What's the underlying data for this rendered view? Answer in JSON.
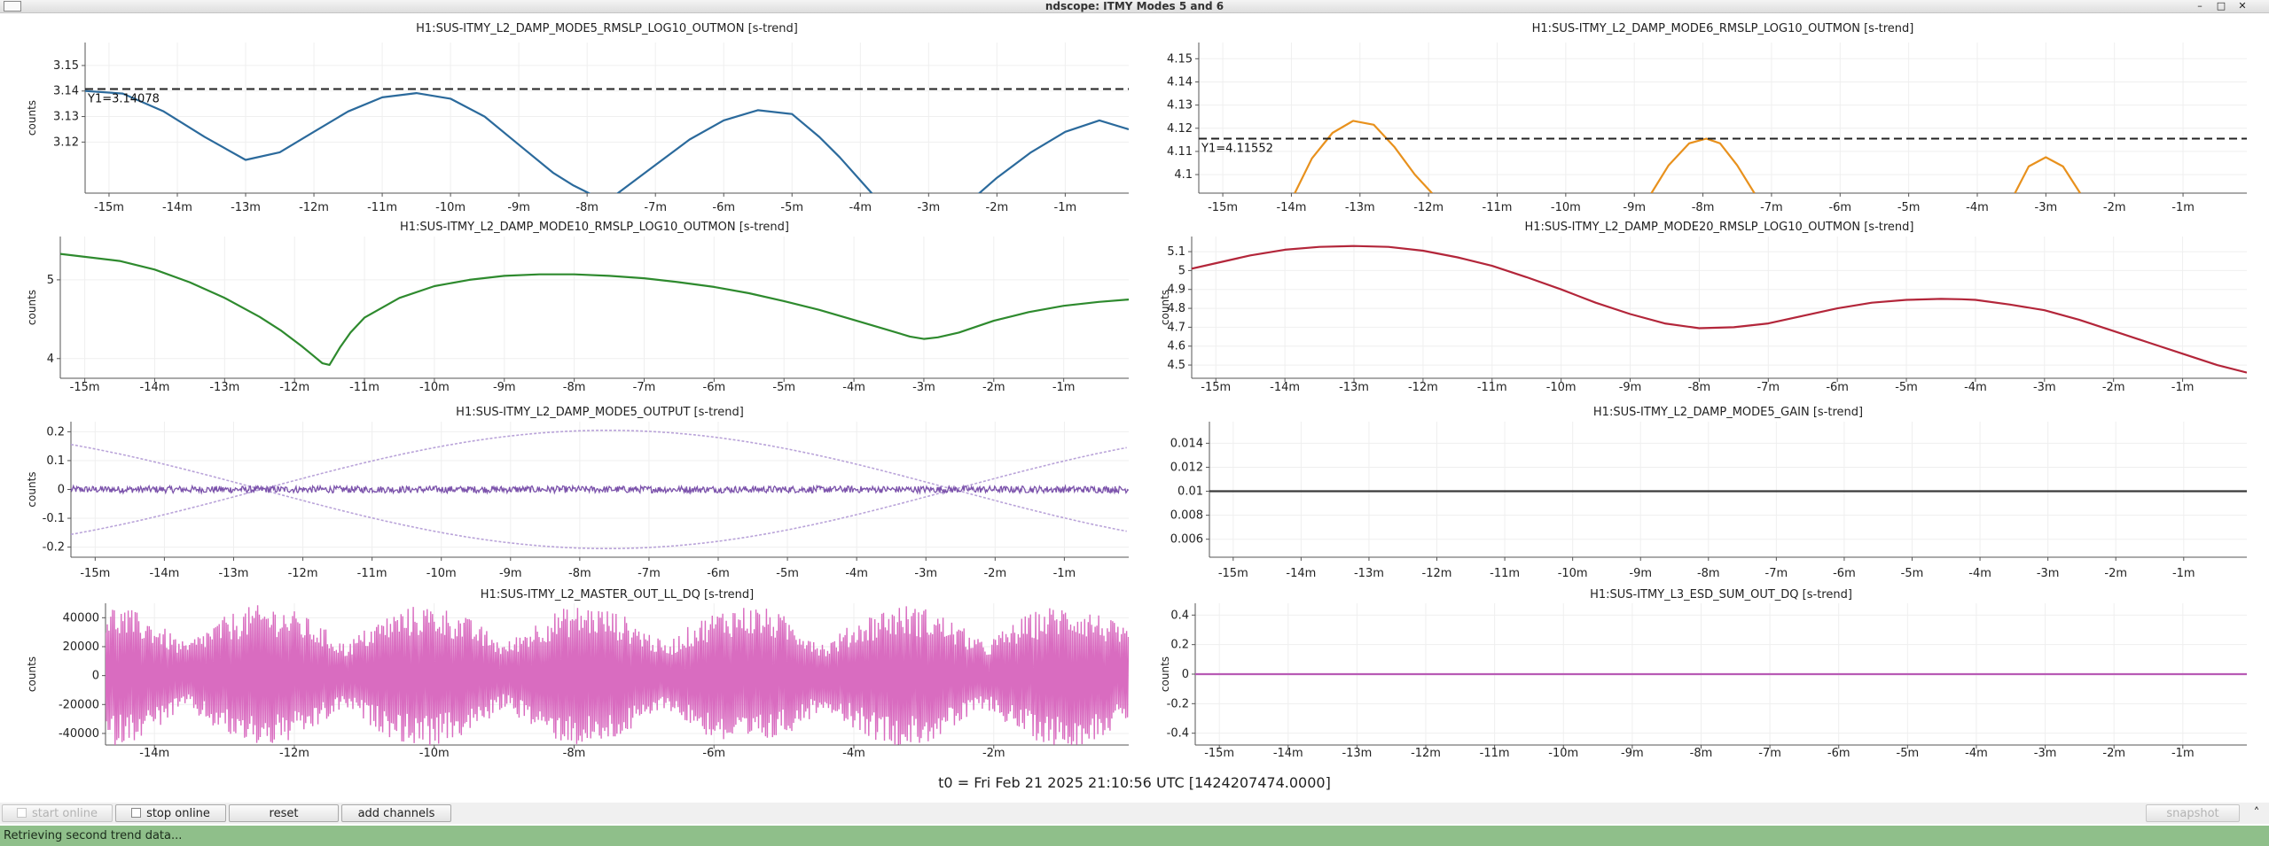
{
  "window": {
    "title": "ndscope: ITMY Modes 5 and 6",
    "minimize_glyph": "–",
    "maximize_glyph": "□",
    "close_glyph": "✕",
    "expand_glyph": "˄"
  },
  "footer": {
    "t0": "t0 = Fri Feb 21 2025 21:10:56 UTC [1424207474.0000]",
    "status": "Retrieving second trend data...",
    "buttons": {
      "start_online": "start online",
      "stop_online": "stop online",
      "reset": "reset",
      "add_channels": "add channels",
      "snapshot": "snapshot"
    }
  },
  "chart_data": [
    {
      "id": "p1",
      "type": "line",
      "title": "H1:SUS-ITMY_L2_DAMP_MODE5_RMSLP_LOG10_OUTMON [s-trend]",
      "ylabel": "counts",
      "color": "#2b6a9c",
      "xlim": [
        -15.35,
        -0.07
      ],
      "ylim": [
        3.1,
        3.159
      ],
      "xticks": [
        -15,
        -14,
        -13,
        -12,
        -11,
        -10,
        -9,
        -8,
        -7,
        -6,
        -5,
        -4,
        -3,
        -2,
        -1
      ],
      "xtick_labels": [
        "-15m",
        "-14m",
        "-13m",
        "-12m",
        "-11m",
        "-10m",
        "-9m",
        "-8m",
        "-7m",
        "-6m",
        "-5m",
        "-4m",
        "-3m",
        "-2m",
        "-1m"
      ],
      "yticks": [
        3.12,
        3.13,
        3.14,
        3.15
      ],
      "ytick_labels": [
        "3.12",
        "3.13",
        "3.14",
        "3.15"
      ],
      "cursor": {
        "y": 3.14078,
        "label": "Y1=3.14078"
      },
      "series": [
        {
          "x": [
            -15.35,
            -14.8,
            -14.2,
            -13.6,
            -13.0,
            -12.5,
            -12.0,
            -11.5,
            -11.0,
            -10.5,
            -10.0,
            -9.5,
            -9.0,
            -8.5,
            -8.2,
            -7.9,
            -7.6,
            -7.0,
            -6.5,
            -6.0,
            -5.5,
            -5.0,
            -4.6,
            -4.3,
            -4.0,
            -3.8,
            -2.3,
            -2.0,
            -1.5,
            -1.0,
            -0.5,
            -0.07
          ],
          "y": [
            3.14,
            3.139,
            3.132,
            3.122,
            3.113,
            3.116,
            3.124,
            3.132,
            3.1375,
            3.1392,
            3.137,
            3.13,
            3.119,
            3.108,
            3.103,
            3.099,
            3.099,
            3.111,
            3.121,
            3.1285,
            3.1325,
            3.131,
            3.122,
            3.114,
            3.105,
            3.099,
            3.099,
            3.106,
            3.116,
            3.124,
            3.1285,
            3.125
          ]
        }
      ]
    },
    {
      "id": "p2",
      "type": "line",
      "title": "H1:SUS-ITMY_L2_DAMP_MODE6_RMSLP_LOG10_OUTMON [s-trend]",
      "ylabel": "",
      "color": "#e8911d",
      "xlim": [
        -15.35,
        -0.07
      ],
      "ylim": [
        4.092,
        4.157
      ],
      "xticks": [
        -15,
        -14,
        -13,
        -12,
        -11,
        -10,
        -9,
        -8,
        -7,
        -6,
        -5,
        -4,
        -3,
        -2,
        -1
      ],
      "xtick_labels": [
        "-15m",
        "-14m",
        "-13m",
        "-12m",
        "-11m",
        "-10m",
        "-9m",
        "-8m",
        "-7m",
        "-6m",
        "-5m",
        "-4m",
        "-3m",
        "-2m",
        "-1m"
      ],
      "yticks": [
        4.1,
        4.11,
        4.12,
        4.13,
        4.14,
        4.15
      ],
      "ytick_labels": [
        "4.1",
        "4.11",
        "4.12",
        "4.13",
        "4.14",
        "4.15"
      ],
      "cursor": {
        "y": 4.11552,
        "label": "Y1=4.11552"
      },
      "series": [
        {
          "x": [
            -13.95,
            -13.7,
            -13.4,
            -13.1,
            -12.8,
            -12.5,
            -12.2,
            -11.95
          ],
          "y": [
            4.092,
            4.107,
            4.118,
            4.1232,
            4.1215,
            4.112,
            4.1,
            4.092
          ]
        },
        {
          "x": [
            -8.75,
            -8.5,
            -8.2,
            -7.95,
            -7.75,
            -7.5,
            -7.25
          ],
          "y": [
            4.092,
            4.104,
            4.1135,
            4.1155,
            4.1135,
            4.104,
            4.092
          ]
        },
        {
          "x": [
            -3.45,
            -3.25,
            -3.0,
            -2.75,
            -2.5
          ],
          "y": [
            4.092,
            4.1035,
            4.1075,
            4.1035,
            4.092
          ]
        }
      ]
    },
    {
      "id": "p3",
      "type": "line",
      "title": "H1:SUS-ITMY_L2_DAMP_MODE10_RMSLP_LOG10_OUTMON [s-trend]",
      "ylabel": "counts",
      "color": "#2e8a2e",
      "xlim": [
        -15.35,
        -0.07
      ],
      "ylim": [
        3.75,
        5.55
      ],
      "xticks": [
        -15,
        -14,
        -13,
        -12,
        -11,
        -10,
        -9,
        -8,
        -7,
        -6,
        -5,
        -4,
        -3,
        -2,
        -1
      ],
      "xtick_labels": [
        "-15m",
        "-14m",
        "-13m",
        "-12m",
        "-11m",
        "-10m",
        "-9m",
        "-8m",
        "-7m",
        "-6m",
        "-5m",
        "-4m",
        "-3m",
        "-2m",
        "-1m"
      ],
      "yticks": [
        4,
        5
      ],
      "ytick_labels": [
        "4",
        "5"
      ],
      "series": [
        {
          "x": [
            -15.35,
            -14.5,
            -14.0,
            -13.5,
            -13.0,
            -12.5,
            -12.2,
            -11.9,
            -11.75,
            -11.6,
            -11.5,
            -11.35,
            -11.2,
            -11.0,
            -10.5,
            -10.0,
            -9.5,
            -9.0,
            -8.5,
            -8.0,
            -7.5,
            -7.0,
            -6.5,
            -6.0,
            -5.5,
            -5.0,
            -4.5,
            -4.0,
            -3.5,
            -3.2,
            -3.0,
            -2.8,
            -2.5,
            -2.0,
            -1.5,
            -1.0,
            -0.5,
            -0.07
          ],
          "y": [
            5.33,
            5.24,
            5.13,
            4.97,
            4.77,
            4.53,
            4.36,
            4.16,
            4.05,
            3.94,
            3.92,
            4.14,
            4.33,
            4.52,
            4.77,
            4.92,
            5.0,
            5.05,
            5.07,
            5.07,
            5.05,
            5.02,
            4.97,
            4.91,
            4.83,
            4.73,
            4.62,
            4.49,
            4.36,
            4.28,
            4.25,
            4.27,
            4.33,
            4.48,
            4.59,
            4.67,
            4.72,
            4.75
          ]
        }
      ]
    },
    {
      "id": "p4",
      "type": "line",
      "title": "H1:SUS-ITMY_L2_DAMP_MODE20_RMSLP_LOG10_OUTMON [s-trend]",
      "ylabel": "counts",
      "color": "#b3263a",
      "xlim": [
        -15.35,
        -0.07
      ],
      "ylim": [
        4.43,
        5.18
      ],
      "xticks": [
        -15,
        -14,
        -13,
        -12,
        -11,
        -10,
        -9,
        -8,
        -7,
        -6,
        -5,
        -4,
        -3,
        -2,
        -1
      ],
      "xtick_labels": [
        "-15m",
        "-14m",
        "-13m",
        "-12m",
        "-11m",
        "-10m",
        "-9m",
        "-8m",
        "-7m",
        "-6m",
        "-5m",
        "-4m",
        "-3m",
        "-2m",
        "-1m"
      ],
      "yticks": [
        4.5,
        4.6,
        4.7,
        4.8,
        4.9,
        5.0,
        5.1
      ],
      "ytick_labels": [
        "4.5",
        "4.6",
        "4.7",
        "4.8",
        "4.9",
        "5",
        "5.1"
      ],
      "series": [
        {
          "x": [
            -15.35,
            -14.5,
            -14.0,
            -13.5,
            -13.0,
            -12.5,
            -12.0,
            -11.5,
            -11.0,
            -10.5,
            -10.0,
            -9.5,
            -9.0,
            -8.5,
            -8.0,
            -7.5,
            -7.0,
            -6.5,
            -6.0,
            -5.5,
            -5.0,
            -4.5,
            -4.2,
            -4.0,
            -3.5,
            -3.0,
            -2.5,
            -2.0,
            -1.5,
            -1.0,
            -0.5,
            -0.07
          ],
          "y": [
            5.01,
            5.08,
            5.11,
            5.125,
            5.13,
            5.125,
            5.105,
            5.07,
            5.025,
            4.965,
            4.9,
            4.83,
            4.77,
            4.72,
            4.695,
            4.7,
            4.72,
            4.76,
            4.8,
            4.83,
            4.845,
            4.85,
            4.848,
            4.845,
            4.82,
            4.79,
            4.74,
            4.68,
            4.62,
            4.56,
            4.5,
            4.46
          ]
        }
      ]
    },
    {
      "id": "p5",
      "type": "line",
      "title": "H1:SUS-ITMY_L2_DAMP_MODE5_OUTPUT [s-trend]",
      "ylabel": "counts",
      "color": "#7b52ab",
      "xlim": [
        -15.35,
        -0.07
      ],
      "ylim": [
        -0.235,
        0.235
      ],
      "xticks": [
        -15,
        -14,
        -13,
        -12,
        -11,
        -10,
        -9,
        -8,
        -7,
        -6,
        -5,
        -4,
        -3,
        -2,
        -1
      ],
      "xtick_labels": [
        "-15m",
        "-14m",
        "-13m",
        "-12m",
        "-11m",
        "-10m",
        "-9m",
        "-8m",
        "-7m",
        "-6m",
        "-5m",
        "-4m",
        "-3m",
        "-2m",
        "-1m"
      ],
      "yticks": [
        -0.2,
        -0.1,
        0,
        0.1,
        0.2
      ],
      "ytick_labels": [
        "-0.2",
        "-0.1",
        "0",
        "0.1",
        "0.2"
      ],
      "envelope": {
        "amplitude": 0.205,
        "zero_crossings": [
          -12.6,
          -7.6,
          -2.6
        ],
        "mean_band": 0.012
      },
      "series": [
        {
          "name": "mean",
          "y": 0.0
        }
      ]
    },
    {
      "id": "p6",
      "type": "line",
      "title": "H1:SUS-ITMY_L2_DAMP_MODE5_GAIN [s-trend]",
      "ylabel": "",
      "color": "#3a3a3a",
      "xlim": [
        -15.35,
        -0.07
      ],
      "ylim": [
        0.0045,
        0.0158
      ],
      "xticks": [
        -15,
        -14,
        -13,
        -12,
        -11,
        -10,
        -9,
        -8,
        -7,
        -6,
        -5,
        -4,
        -3,
        -2,
        -1
      ],
      "xtick_labels": [
        "-15m",
        "-14m",
        "-13m",
        "-12m",
        "-11m",
        "-10m",
        "-9m",
        "-8m",
        "-7m",
        "-6m",
        "-5m",
        "-4m",
        "-3m",
        "-2m",
        "-1m"
      ],
      "yticks": [
        0.006,
        0.008,
        0.01,
        0.012,
        0.014
      ],
      "ytick_labels": [
        "0.006",
        "0.008",
        "0.01",
        "0.012",
        "0.014"
      ],
      "series": [
        {
          "x": [
            -15.35,
            -0.07
          ],
          "y": [
            0.01,
            0.01
          ]
        }
      ]
    },
    {
      "id": "p7",
      "type": "line",
      "title": "H1:SUS-ITMY_L2_MASTER_OUT_LL_DQ [s-trend]",
      "ylabel": "counts",
      "color": "#d96cc0",
      "xlim": [
        -14.7,
        -0.07
      ],
      "ylim": [
        -48000,
        50000
      ],
      "xticks": [
        -14,
        -12,
        -10,
        -8,
        -6,
        -4,
        -2
      ],
      "xtick_labels": [
        "-14m",
        "-12m",
        "-10m",
        "-8m",
        "-6m",
        "-4m",
        "-2m"
      ],
      "yticks": [
        -40000,
        -20000,
        0,
        20000,
        40000
      ],
      "ytick_labels": [
        "-40000",
        "-20000",
        "0",
        "20000",
        "40000"
      ],
      "envelope": {
        "amplitude": 49000,
        "beats": 3.2,
        "min_fraction": 0.45
      }
    },
    {
      "id": "p8",
      "type": "line",
      "title": "H1:SUS-ITMY_L3_ESD_SUM_OUT_DQ [s-trend]",
      "ylabel": "counts",
      "color": "#b85bb5",
      "xlim": [
        -15.35,
        -0.07
      ],
      "ylim": [
        -0.48,
        0.48
      ],
      "xticks": [
        -15,
        -14,
        -13,
        -12,
        -11,
        -10,
        -9,
        -8,
        -7,
        -6,
        -5,
        -4,
        -3,
        -2,
        -1
      ],
      "xtick_labels": [
        "-15m",
        "-14m",
        "-13m",
        "-12m",
        "-11m",
        "-10m",
        "-9m",
        "-8m",
        "-7m",
        "-6m",
        "-5m",
        "-4m",
        "-3m",
        "-2m",
        "-1m"
      ],
      "yticks": [
        -0.4,
        -0.2,
        0,
        0.2,
        0.4
      ],
      "ytick_labels": [
        "-0.4",
        "-0.2",
        "0",
        "0.2",
        "0.4"
      ],
      "series": [
        {
          "x": [
            -15.35,
            -0.07
          ],
          "y": [
            0,
            0
          ]
        }
      ]
    }
  ]
}
